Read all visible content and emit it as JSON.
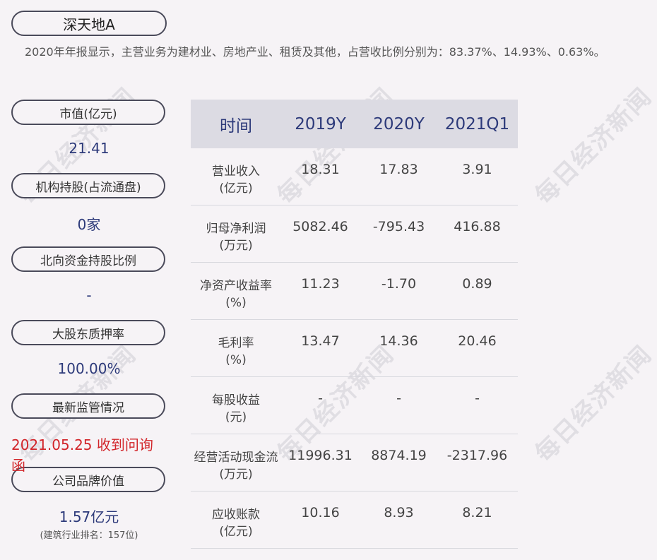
{
  "title": "深天地A",
  "summary": "2020年年报显示，主营业务为建材业、房地产业、租赁及其他，占营收比例分别为：83.37%、14.93%、0.63%。",
  "left_panel": [
    {
      "label": "市值(亿元)",
      "value": "21.41"
    },
    {
      "label": "机构持股(占流通盘)",
      "value": "0家"
    },
    {
      "label": "北向资金持股比例",
      "value": "-"
    },
    {
      "label": "大股东质押率",
      "value": "100.00%"
    },
    {
      "label": "最新监管情况",
      "value": "2021.05.25 收到问询函"
    },
    {
      "label": "公司品牌价值",
      "value": "1.57亿元",
      "note": "(建筑行业排名：157位)"
    }
  ],
  "table": {
    "headers": [
      "时间",
      "2019Y",
      "2020Y",
      "2021Q1"
    ],
    "rows": [
      {
        "label": "营业收入",
        "unit": "(亿元)",
        "values": [
          "18.31",
          "17.83",
          "3.91"
        ]
      },
      {
        "label": "归母净利润",
        "unit": "(万元)",
        "values": [
          "5082.46",
          "-795.43",
          "416.88"
        ]
      },
      {
        "label": "净资产收益率",
        "unit": "(%)",
        "values": [
          "11.23",
          "-1.70",
          "0.89"
        ]
      },
      {
        "label": "毛利率",
        "unit": "(%)",
        "values": [
          "13.47",
          "14.36",
          "20.46"
        ]
      },
      {
        "label": "每股收益",
        "unit": "(元)",
        "values": [
          "-",
          "-",
          "-"
        ]
      },
      {
        "label": "经营活动现金流",
        "unit": "(万元)",
        "values": [
          "11996.31",
          "8874.19",
          "-2317.96"
        ]
      },
      {
        "label": "应收账款",
        "unit": "(亿元)",
        "values": [
          "10.16",
          "8.93",
          "8.21"
        ]
      }
    ]
  },
  "watermark": "每日经济新闻",
  "colors": {
    "accent_blue": "#2d3a7a",
    "alert_red": "#d2252a",
    "header_bg": "#dcdbe3"
  }
}
